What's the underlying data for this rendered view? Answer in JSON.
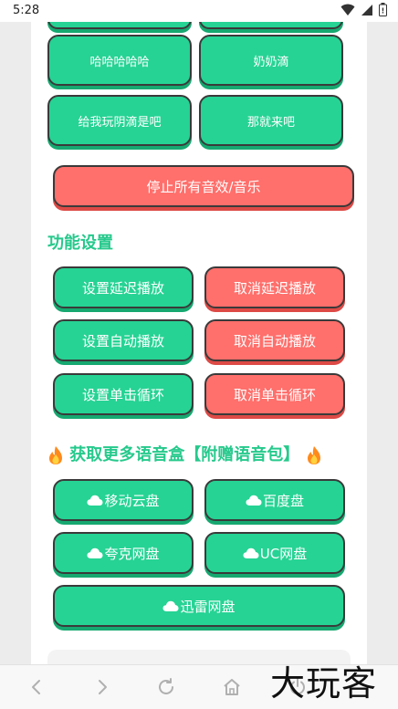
{
  "status_bar": {
    "time": "5:28",
    "icons": [
      "wifi-icon",
      "cellular-signal-icon",
      "battery-icon"
    ]
  },
  "sound_buttons": [
    {
      "label": "哈哈哈哈哈"
    },
    {
      "label": "奶奶滴"
    },
    {
      "label": "给我玩阴滴是吧"
    },
    {
      "label": "那就来吧"
    }
  ],
  "stop_all_label": "停止所有音效/音乐",
  "function_settings": {
    "title": "功能设置",
    "buttons": [
      {
        "label": "设置延迟播放"
      },
      {
        "label": "取消延迟播放"
      },
      {
        "label": "设置自动播放"
      },
      {
        "label": "取消自动播放"
      },
      {
        "label": "设置单击循环"
      },
      {
        "label": "取消单击循环"
      }
    ]
  },
  "more_voice_boxes": {
    "title": "获取更多语音盒【附赠语音包】",
    "icon": "fire-icon",
    "links": [
      {
        "label": "移动云盘"
      },
      {
        "label": "百度盘"
      },
      {
        "label": "夸克网盘"
      },
      {
        "label": "UC网盘"
      },
      {
        "label": "迅雷网盘"
      }
    ]
  },
  "nav_bar": {
    "icons": [
      "back-icon",
      "forward-icon",
      "refresh-icon",
      "home-icon",
      "power-icon"
    ]
  },
  "watermark": "大玩客",
  "colors": {
    "green": "#26d394",
    "red": "#ff6f6b",
    "title_green": "#26c98c",
    "background": "#ececec"
  }
}
